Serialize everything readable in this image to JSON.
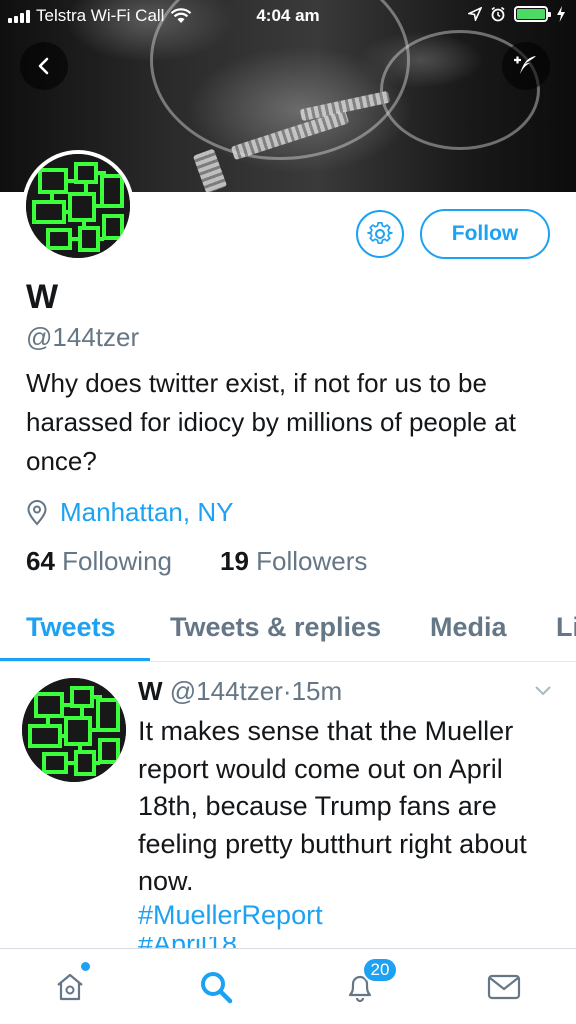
{
  "status_bar": {
    "carrier": "Telstra Wi-Fi Call",
    "time": "4:04 am"
  },
  "profile": {
    "name": "W",
    "handle": "@144tzer",
    "bio": "Why does twitter exist, if not for us to be harassed for idiocy by millions of people at once?",
    "location": "Manhattan, NY",
    "following_count": "64",
    "following_label": "Following",
    "followers_count": "19",
    "followers_label": "Followers",
    "follow_label": "Follow"
  },
  "tabs": [
    {
      "label": "Tweets",
      "active": true
    },
    {
      "label": "Tweets & replies",
      "active": false
    },
    {
      "label": "Media",
      "active": false
    },
    {
      "label": "Li",
      "active": false
    }
  ],
  "tweet": {
    "name": "W",
    "handle": "@144tzer",
    "separator": "·",
    "time": "15m",
    "text": "It makes sense that the Mueller report would come out on April 18th, because Trump fans are feeling pretty butthurt right about now.",
    "hashtag": "#MuellerReport",
    "hashtag_partial": "#April18"
  },
  "bottom_nav": {
    "notifications_badge": "20",
    "items": [
      "home-icon",
      "search-icon",
      "notifications-icon",
      "messages-icon"
    ]
  },
  "colors": {
    "accent": "#1da1f2",
    "secondary_text": "#657786",
    "battery": "#4cd964"
  }
}
